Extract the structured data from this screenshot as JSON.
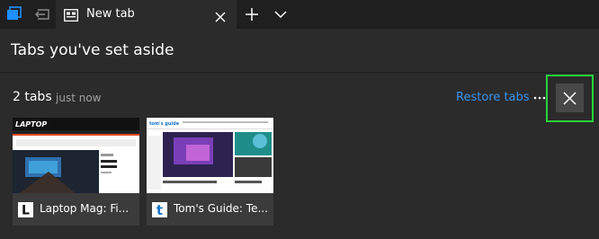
{
  "tab": {
    "label": "New tab"
  },
  "panel": {
    "title": "Tabs you've set aside"
  },
  "group": {
    "count": "2 tabs",
    "time": "just now",
    "restore_label": "Restore tabs"
  },
  "thumbnails": [
    {
      "title": "Laptop Mag: Fi...",
      "favicon_letter": "L",
      "logo_text": "LAPTOP"
    },
    {
      "title": "Tom's Guide: Te...",
      "favicon_letter": "t",
      "logo_text": "tom's guide"
    }
  ],
  "colors": {
    "background": "#2b2b2b",
    "tabbar": "#1f1f1f",
    "link": "#3a93e8",
    "highlight_border": "#27d43a",
    "edge_blue": "#1e90ff"
  }
}
